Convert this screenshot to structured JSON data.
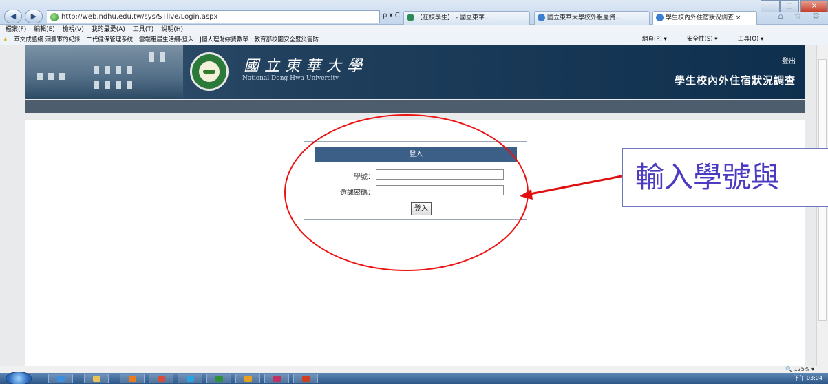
{
  "browser": {
    "address": "http://web.ndhu.edu.tw/sys/STlive/Login.aspx",
    "address_tools": "ρ ▾ C",
    "tabs": [
      {
        "label": "【在校學生】 - 國立東華...",
        "icon_color": "#2e8b57"
      },
      {
        "label": "國立東華大學校外租屋資...",
        "icon_color": "#3c7fd1"
      },
      {
        "label": "學生校內外住宿狀況調查 ×",
        "icon_color": "#3c7fd1"
      }
    ],
    "window_buttons": [
      "–",
      "□",
      "×"
    ],
    "right_icons": "⌂ ☆ ⚙",
    "menu": [
      "檔案(F)",
      "編輯(E)",
      "檢視(V)",
      "我的最愛(A)",
      "工具(T)",
      "說明(H)"
    ],
    "favorites": [
      "華文成語網 洄瀾軍的紀錄",
      "二代健保管理系統",
      "雲端租屋生活網-登入",
      "J個人理財綜費數單",
      "教育部校園安全暨災害防..."
    ],
    "commands": [
      "網頁(P) ▾",
      "安全性(S) ▾",
      "工具(O) ▾"
    ]
  },
  "header": {
    "university_cn": "國立東華大學",
    "university_en": "National Dong Hwa University",
    "logout": "登出",
    "system_title": "學生校內外住宿狀況調查"
  },
  "login": {
    "title": "登入",
    "student_id_label": "學號：",
    "password_label": "選課密碼：",
    "student_id_value": "",
    "password_value": "",
    "submit": "登入"
  },
  "annotation": {
    "callout_text": "輸入學號與",
    "arrow_color": "#e01010"
  },
  "status": {
    "zoom": "🔍 125%  ▾",
    "clock": "下午 03:04"
  }
}
